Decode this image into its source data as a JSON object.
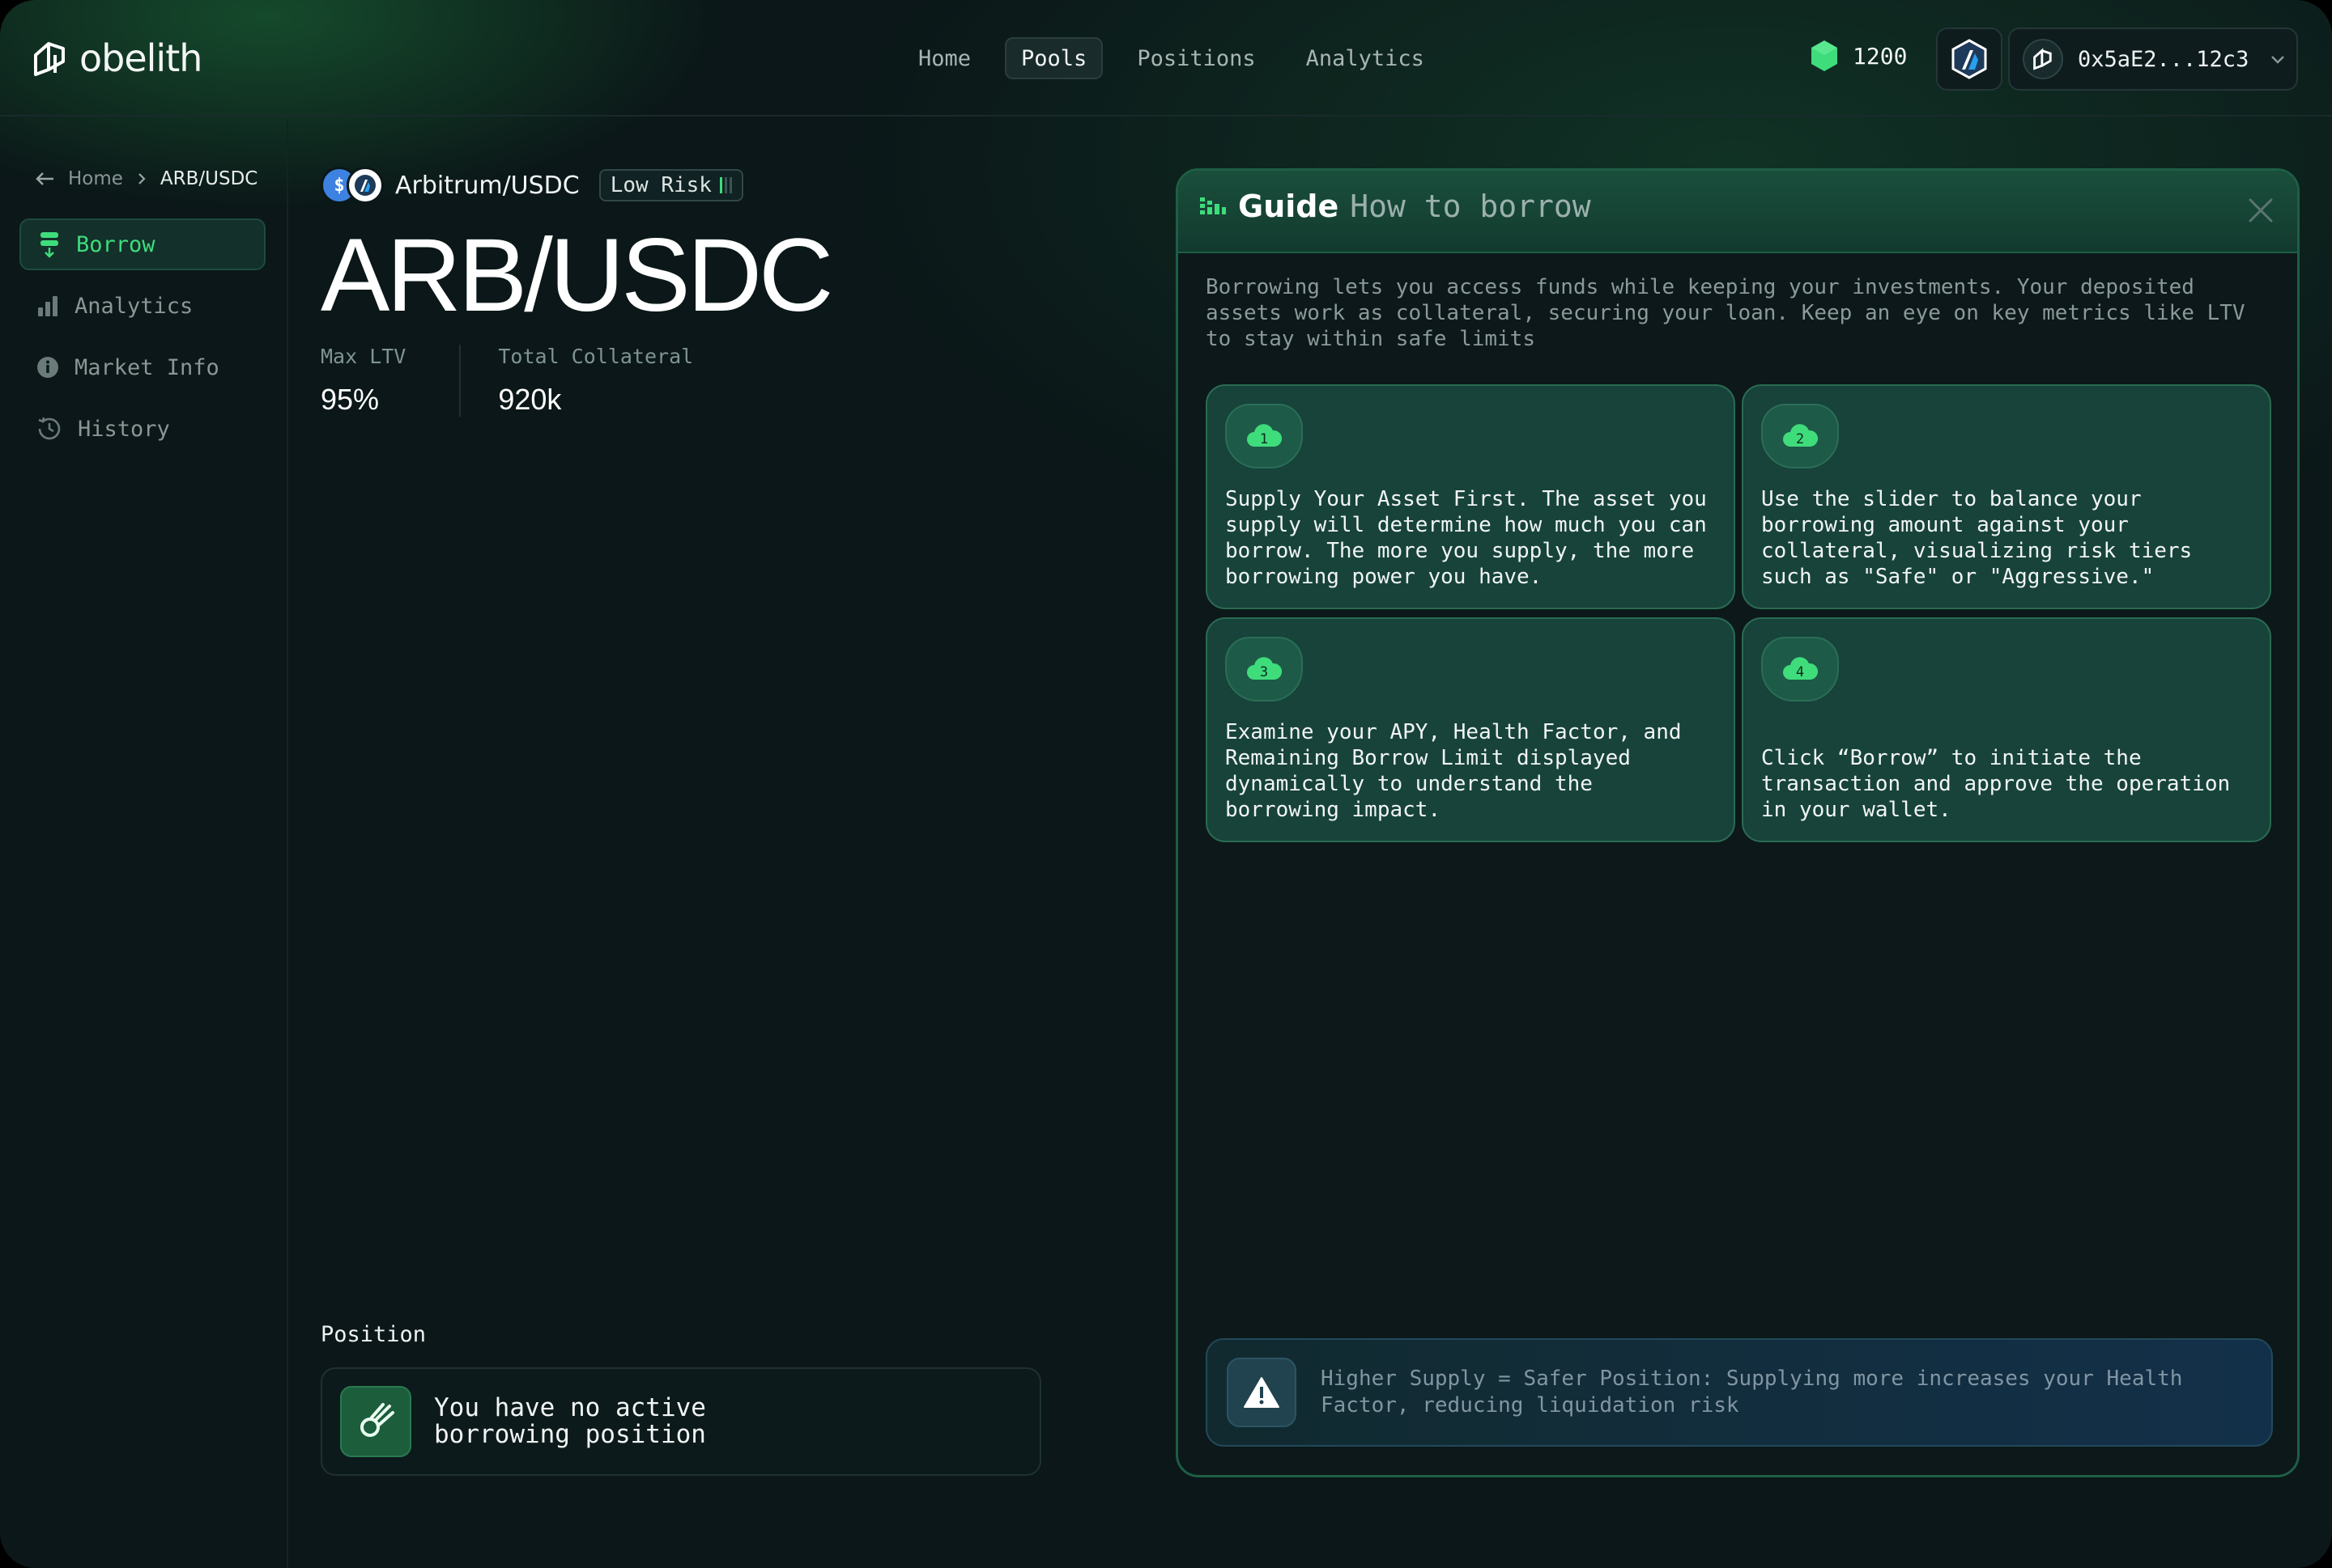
{
  "brand": {
    "name": "obelith"
  },
  "nav": {
    "items": [
      {
        "label": "Home",
        "active": false
      },
      {
        "label": "Pools",
        "active": true
      },
      {
        "label": "Positions",
        "active": false
      },
      {
        "label": "Analytics",
        "active": false
      }
    ]
  },
  "header": {
    "points": "1200",
    "points_icon": "green-hexagon-icon",
    "chain_icon": "arbitrum-icon",
    "wallet_address": "0x5aE2...12c3"
  },
  "breadcrumb": {
    "home": "Home",
    "current": "ARB/USDC"
  },
  "sidebar": {
    "items": [
      {
        "label": "Borrow",
        "icon": "borrow-icon",
        "active": true
      },
      {
        "label": "Analytics",
        "icon": "bar-chart-icon",
        "active": false
      },
      {
        "label": "Market Info",
        "icon": "info-icon",
        "active": false
      },
      {
        "label": "History",
        "icon": "history-icon",
        "active": false
      }
    ]
  },
  "pool": {
    "pair_name": "Arbitrum/USDC",
    "risk_label": "Low Risk",
    "risk_level_bars": "1/3",
    "title": "ARB/USDC",
    "stats": [
      {
        "label": "Max LTV",
        "value": "95%"
      },
      {
        "label": "Total Collateral",
        "value": "920k"
      }
    ]
  },
  "position": {
    "title": "Position",
    "empty_text": "You have no active borrowing position"
  },
  "guide": {
    "title": "Guide",
    "subtitle": "How to borrow",
    "description": "Borrowing lets you access funds while keeping your investments. Your deposited assets work as collateral, securing your loan. Keep an eye on key metrics like LTV to stay within safe limits",
    "steps": [
      {
        "number": "1",
        "text": "Supply Your Asset First. The asset you supply will determine how much you can borrow. The more you supply, the more borrowing power you have."
      },
      {
        "number": "2",
        "text": "Use the slider to balance your borrowing amount against your collateral, visualizing risk tiers such as \"Safe\" or \"Aggressive.\""
      },
      {
        "number": "3",
        "text": "Examine your APY, Health Factor, and Remaining Borrow Limit displayed dynamically to understand the borrowing impact."
      },
      {
        "number": "4",
        "text": "Click “Borrow” to initiate the transaction and approve the operation in your wallet."
      }
    ],
    "tip": "Higher Supply = Safer Position: Supplying more increases your Health Factor, reducing liquidation risk"
  },
  "colors": {
    "accent": "#3fdc7c",
    "background": "#0b1718",
    "card": "#17433a"
  }
}
